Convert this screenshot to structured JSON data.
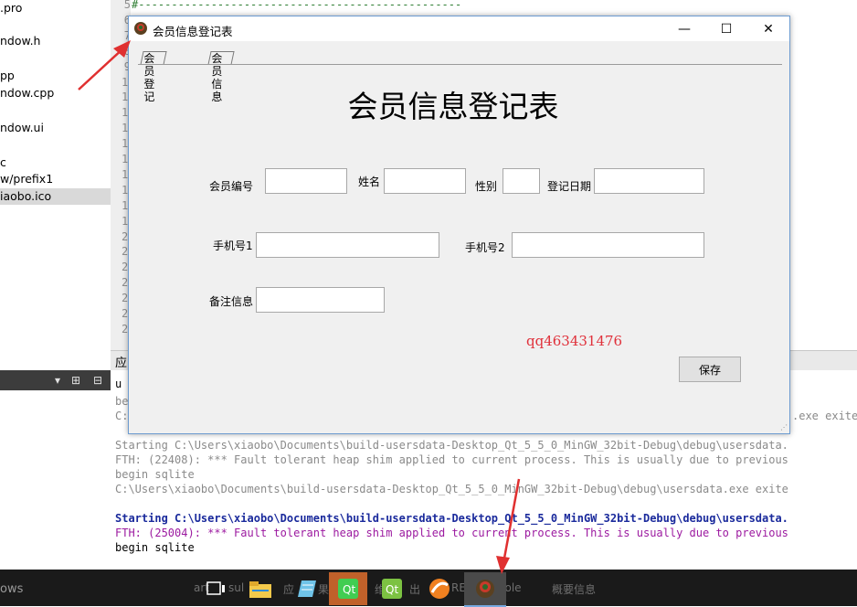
{
  "project_tree": {
    "items": [
      ".pro",
      "ndow.h",
      "pp",
      "ndow.cpp",
      "ndow.ui",
      "c",
      "w/prefix1",
      "iaobo.ico"
    ],
    "selected_index": 7
  },
  "editor": {
    "line_numbers": [
      "5",
      "6",
      "7",
      "8",
      "9",
      "10",
      "11",
      "12",
      "13",
      "14",
      "15",
      "16",
      "17",
      "18",
      "19",
      "20",
      "21",
      "22",
      "23",
      "24",
      "25",
      "26"
    ],
    "code_line_5": "#-------------------------------------------------"
  },
  "output_pane": {
    "title": "应",
    "lines": [
      {
        "text": "u",
        "style": "black"
      },
      {
        "text": "be",
        "style": "gray"
      },
      {
        "text": "C:",
        "style": "gray"
      },
      {
        "text": ".exe exite",
        "style": "gray"
      },
      {
        "text": "Starting C:\\Users\\xiaobo\\Documents\\build-usersdata-Desktop_Qt_5_5_0_MinGW_32bit-Debug\\debug\\usersdata.",
        "style": "gray"
      },
      {
        "text": "FTH: (22408): *** Fault tolerant heap shim applied to current process. This is usually due to previous",
        "style": "gray"
      },
      {
        "text": "begin sqlite",
        "style": "gray"
      },
      {
        "text": "C:\\Users\\xiaobo\\Documents\\build-usersdata-Desktop_Qt_5_5_0_MinGW_32bit-Debug\\debug\\usersdata.exe exite",
        "style": "gray"
      },
      {
        "text": "Starting C:\\Users\\xiaobo\\Documents\\build-usersdata-Desktop_Qt_5_5_0_MinGW_32bit-Debug\\debug\\usersdata.",
        "style": "blue"
      },
      {
        "text": "FTH: (25004): *** Fault tolerant heap shim applied to current process. This is usually due to previous",
        "style": "purple"
      },
      {
        "text": "begin sqlite",
        "style": "black"
      }
    ]
  },
  "taskbar": {
    "start_text": "ows",
    "faint_labels": [
      "art",
      "sul",
      "应",
      "果",
      "维",
      "出",
      "RE",
      "ssole",
      "概要信息"
    ]
  },
  "dialog": {
    "title": "会员信息登记表",
    "controls": {
      "minimize": "—",
      "maximize": "☐",
      "close": "✕"
    },
    "tabs": [
      "会员登记",
      "会员信息"
    ],
    "heading": "会员信息登记表",
    "labels": {
      "member_no": "会员编号",
      "name": "姓名",
      "gender": "性别",
      "reg_date": "登记日期",
      "phone1": "手机号1",
      "phone2": "手机号2",
      "remark": "备注信息"
    },
    "values": {
      "member_no": "",
      "name": "",
      "gender": "",
      "reg_date": "",
      "phone1": "",
      "phone2": "",
      "remark": ""
    },
    "watermark": "qq463431476",
    "save_label": "保存"
  },
  "colors": {
    "arrow": "#e03030",
    "window_border": "#6c9bd0",
    "watermark": "#e0303a"
  }
}
